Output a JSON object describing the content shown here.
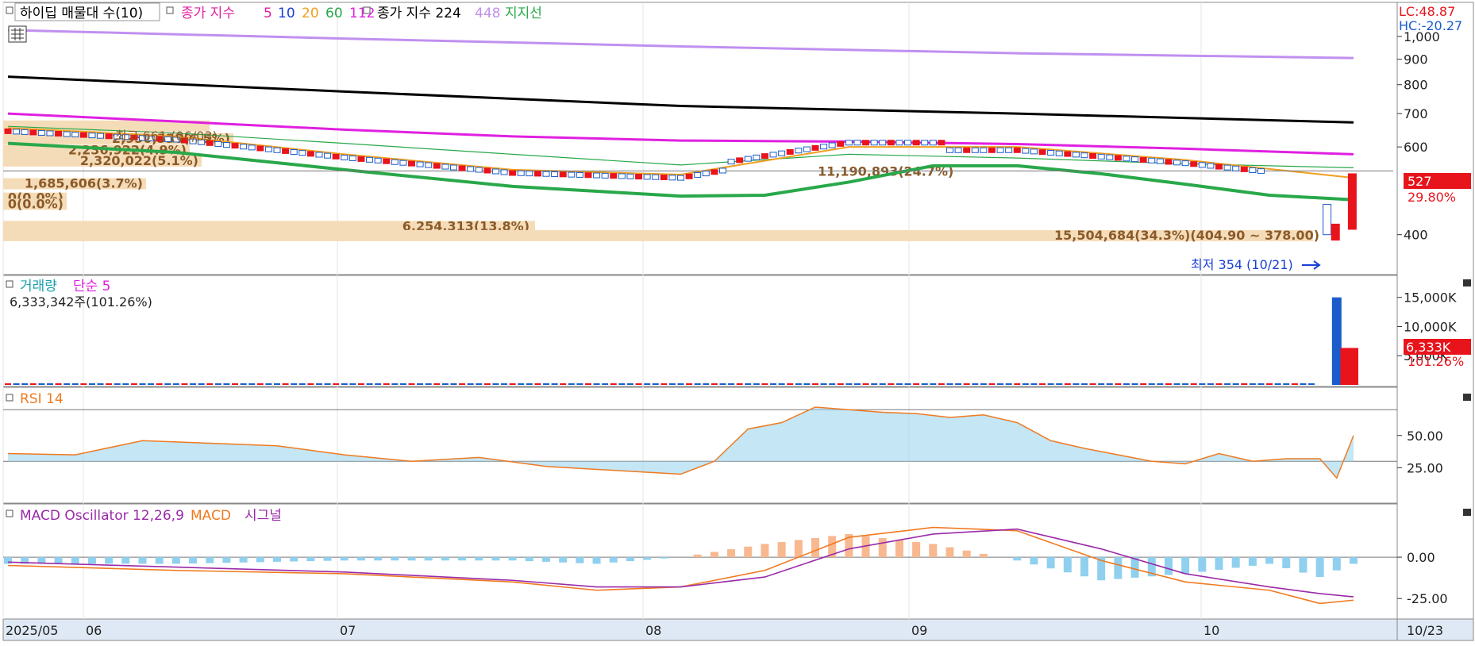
{
  "legend_price": {
    "title": "하이딥 매물대 수(10)",
    "ma_label": "종가 지수",
    "ma_periods": [
      "5",
      "10",
      "20",
      "60",
      "112"
    ],
    "ma2_label": "종가 지수 224",
    "ma2_period": "448",
    "support": "지지선"
  },
  "legend_volume": {
    "title": "거래량",
    "ma": "단순 5",
    "readout": "6,333,342주(101.26%)"
  },
  "legend_rsi": {
    "title": "RSI 14"
  },
  "legend_macd": {
    "osc": "MACD Oscillator 12,26,9",
    "macd": "MACD",
    "signal": "시그널"
  },
  "right_top": {
    "lc": "LC:48.87",
    "hc": "HC:-20.27"
  },
  "current_price": {
    "value": "527",
    "pct": "29.80%"
  },
  "current_volume": {
    "value": "6,333K",
    "pct": "101.26%"
  },
  "annotations": {
    "high": "최고 661 (06/03)",
    "low": "최저 354 (10/21)"
  },
  "x_axis": {
    "labels": [
      "2025/05",
      "06",
      "07",
      "08",
      "09",
      "10"
    ],
    "last_date": "10/23"
  },
  "colors": {
    "up": "#e8141c",
    "down": "#1a5ccc",
    "ma5": "#1a3fd6",
    "ma10": "#1a3fd6",
    "ma20": "#f0a020",
    "ma60": "#29a84a",
    "ma112": "#e020e0",
    "ma224": "#000000",
    "ma448": "#c090f0",
    "rsi": "#f07a20",
    "macd": "#f07a20",
    "signal": "#9a2aa8",
    "osc_pos": "#f8b890",
    "osc_neg": "#90d0ee",
    "volume_profile": "#f5dcb8"
  },
  "chart_data": [
    {
      "type": "line",
      "panel": "price",
      "y_ticks": [
        "1,000",
        "900",
        "800",
        "700",
        "600",
        "400"
      ],
      "ylim_log": [
        340,
        1060
      ],
      "series": [
        {
          "name": "448",
          "x": [
            0,
            40,
            80,
            120,
            160
          ],
          "values": [
            1030,
            990,
            955,
            925,
            905
          ]
        },
        {
          "name": "224",
          "x": [
            0,
            40,
            80,
            120,
            160
          ],
          "values": [
            830,
            775,
            725,
            700,
            672
          ]
        },
        {
          "name": "112",
          "x": [
            0,
            20,
            40,
            60,
            80,
            100,
            120,
            140,
            160
          ],
          "values": [
            700,
            675,
            650,
            630,
            618,
            615,
            608,
            595,
            580
          ]
        },
        {
          "name": "60",
          "x": [
            0,
            20,
            40,
            60,
            80,
            100,
            120,
            140,
            160
          ],
          "values": [
            660,
            640,
            610,
            580,
            552,
            580,
            570,
            555,
            545
          ]
        },
        {
          "name": "20",
          "x": [
            0,
            20,
            40,
            60,
            80,
            100,
            120,
            140,
            160
          ],
          "values": [
            655,
            630,
            580,
            540,
            528,
            600,
            600,
            565,
            520
          ]
        },
        {
          "name": "지지선",
          "x": [
            0,
            20,
            40,
            60,
            80,
            90,
            100,
            110,
            120,
            130,
            140,
            150,
            160
          ],
          "values": [
            610,
            585,
            540,
            500,
            478,
            480,
            510,
            550,
            550,
            530,
            505,
            480,
            470
          ]
        }
      ],
      "volume_profile": [
        {
          "label": "최고 661 (06/03)",
          "price": 649
        },
        {
          "label": "2,950,538(6.5%)",
          "price": 612
        },
        {
          "label": "2,236,922(4.9%)",
          "price": 580
        },
        {
          "label": "2,320,022(5.1%)",
          "price": 552
        },
        {
          "label": "1,685,606(3.7%)",
          "price": 497
        },
        {
          "label": "0(0.0%)",
          "price": 465
        },
        {
          "label": "0(0.0%)",
          "price": 452
        },
        {
          "label": "6,254,313(13.8%)",
          "price": 408
        },
        {
          "label": "11,190,893(24.7%)",
          "price": 525
        },
        {
          "label": "15,504,684(34.3%)(404.90 ~ 378.00)",
          "price": 391
        }
      ]
    },
    {
      "type": "bar",
      "panel": "volume",
      "y_ticks": [
        "15,000K",
        "10,000K",
        "5,000K"
      ],
      "ylim": [
        0,
        17000
      ],
      "values_k": [
        {
          "x": 158,
          "value": 15000,
          "dir": "down"
        },
        {
          "x": 159,
          "value": 6333,
          "dir": "up"
        },
        {
          "x": 160,
          "value": 6333,
          "dir": "up"
        }
      ]
    },
    {
      "type": "line",
      "panel": "rsi",
      "y_ticks": [
        "50.00",
        "25.00"
      ],
      "ylim": [
        0,
        80
      ],
      "series": [
        {
          "name": "RSI 14",
          "x": [
            0,
            8,
            16,
            24,
            32,
            40,
            48,
            56,
            64,
            72,
            80,
            84,
            88,
            92,
            96,
            100,
            104,
            108,
            112,
            116,
            120,
            124,
            128,
            132,
            136,
            140,
            144,
            148,
            152,
            156,
            158,
            160
          ],
          "values": [
            36,
            35,
            46,
            44,
            42,
            35,
            30,
            33,
            26,
            23,
            20,
            30,
            55,
            60,
            72,
            70,
            68,
            67,
            64,
            66,
            60,
            46,
            40,
            35,
            30,
            28,
            36,
            30,
            32,
            32,
            17,
            50
          ]
        }
      ]
    },
    {
      "type": "line",
      "panel": "macd",
      "y_ticks": [
        "0.00",
        "-25.00"
      ],
      "ylim": [
        -35,
        25
      ],
      "series": [
        {
          "name": "MACD",
          "x": [
            0,
            20,
            40,
            60,
            70,
            80,
            90,
            100,
            110,
            120,
            130,
            140,
            150,
            156,
            160
          ],
          "values": [
            -5,
            -8,
            -10,
            -15,
            -20,
            -18,
            -8,
            12,
            18,
            16,
            -2,
            -15,
            -20,
            -28,
            -26
          ]
        },
        {
          "name": "시그널",
          "x": [
            0,
            20,
            40,
            60,
            70,
            80,
            90,
            100,
            110,
            120,
            130,
            140,
            150,
            156,
            160
          ],
          "values": [
            -3,
            -6,
            -9,
            -14,
            -18,
            -18,
            -12,
            5,
            14,
            17,
            5,
            -10,
            -18,
            -22,
            -24
          ]
        }
      ]
    }
  ]
}
